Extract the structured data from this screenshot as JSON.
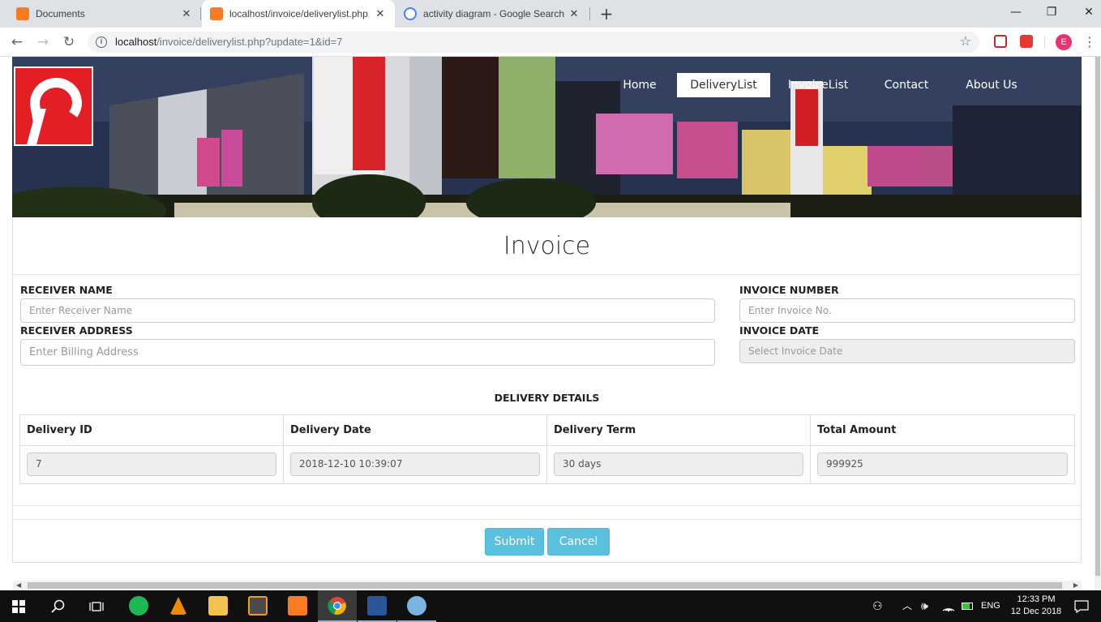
{
  "browser": {
    "tabs": [
      {
        "title": "Documents",
        "active": false
      },
      {
        "title": "localhost/invoice/deliverylist.php",
        "active": true
      },
      {
        "title": "activity diagram - Google Search",
        "active": false
      }
    ],
    "url_host": "localhost",
    "url_path": "/invoice/deliverylist.php?update=1&id=7",
    "profile_initial": "E"
  },
  "nav": {
    "items": [
      {
        "label": "Home"
      },
      {
        "label": "DeliveryList"
      },
      {
        "label": "InvoiceList"
      },
      {
        "label": "Contact"
      },
      {
        "label": "About Us"
      }
    ]
  },
  "form": {
    "title": "Invoice",
    "receiver_name_label": "RECEIVER NAME",
    "receiver_name_placeholder": "Enter Receiver Name",
    "receiver_address_label": "RECEIVER ADDRESS",
    "receiver_address_placeholder": "Enter Billing Address",
    "invoice_number_label": "INVOICE NUMBER",
    "invoice_number_placeholder": "Enter Invoice No.",
    "invoice_date_label": "INVOICE DATE",
    "invoice_date_placeholder": "Select Invoice Date"
  },
  "delivery": {
    "section_title": "DELIVERY DETAILS",
    "columns": [
      "Delivery ID",
      "Delivery Date",
      "Delivery Term",
      "Total Amount"
    ],
    "row": [
      "7",
      "2018-12-10 10:39:07",
      "30 days",
      "999925"
    ]
  },
  "actions": {
    "submit": "Submit",
    "cancel": "Cancel"
  },
  "taskbar": {
    "language": "ENG",
    "time": "12:33 PM",
    "date": "12 Dec 2018"
  },
  "colors": {
    "accent_button": "#5bc0de",
    "brand_red": "#e31e24"
  }
}
